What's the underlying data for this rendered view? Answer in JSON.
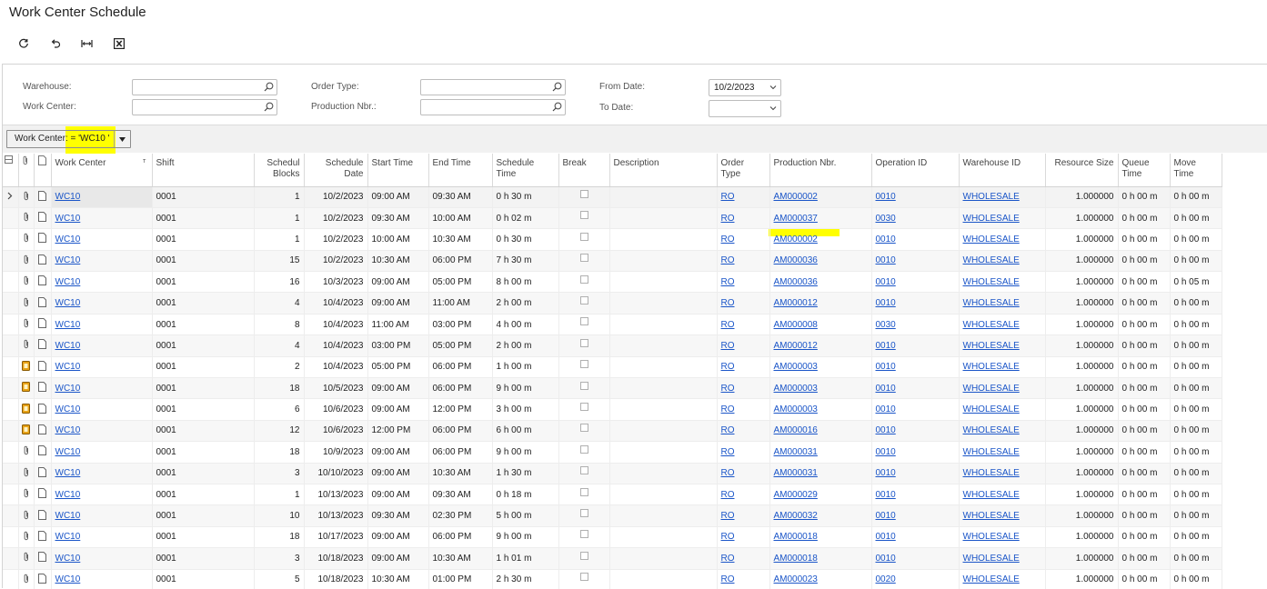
{
  "page": {
    "title": "Work Center Schedule"
  },
  "toolbar": {
    "icons": [
      "refresh-icon",
      "undo-icon",
      "fit-columns-icon",
      "export-excel-icon"
    ]
  },
  "form": {
    "warehouse_label": "Warehouse:",
    "work_center_label": "Work Center:",
    "order_type_label": "Order Type:",
    "production_nbr_label": "Production Nbr.:",
    "from_date_label": "From Date:",
    "from_date_value": "10/2/2023",
    "to_date_label": "To Date:",
    "to_date_value": ""
  },
  "filter": {
    "chip_label": "Work Center: = 'WC10 '"
  },
  "grid": {
    "columns": {
      "work_center": "Work Center",
      "shift": "Shift",
      "schedule_blocks": "Schedul Blocks",
      "schedule_date": "Schedule Date",
      "start_time": "Start Time",
      "end_time": "End Time",
      "schedule_time": "Schedule Time",
      "break": "Break",
      "description": "Description",
      "order_type": "Order Type",
      "production_nbr": "Production Nbr.",
      "operation_id": "Operation ID",
      "warehouse_id": "Warehouse ID",
      "resource_size": "Resource Size",
      "queue_time": "Queue Time",
      "move_time": "Move Time"
    },
    "rows": [
      {
        "wc": "WC10",
        "shift": "0001",
        "blocks": "1",
        "date": "10/2/2023",
        "start": "09:00 AM",
        "end": "09:30 AM",
        "sched": "0 h 30 m",
        "ot": "RO",
        "prod": "AM000002",
        "op": "0010",
        "wh": "WHOLESALE",
        "res": "1.000000",
        "queue": "0 h 00 m",
        "move": "0 h 00 m",
        "note": false
      },
      {
        "wc": "WC10",
        "shift": "0001",
        "blocks": "1",
        "date": "10/2/2023",
        "start": "09:30 AM",
        "end": "10:00 AM",
        "sched": "0 h 02 m",
        "ot": "RO",
        "prod": "AM000037",
        "op": "0030",
        "wh": "WHOLESALE",
        "res": "1.000000",
        "queue": "0 h 00 m",
        "move": "0 h 00 m",
        "note": false
      },
      {
        "wc": "WC10",
        "shift": "0001",
        "blocks": "1",
        "date": "10/2/2023",
        "start": "10:00 AM",
        "end": "10:30 AM",
        "sched": "0 h 30 m",
        "ot": "RO",
        "prod": "AM000002",
        "op": "0010",
        "wh": "WHOLESALE",
        "res": "1.000000",
        "queue": "0 h 00 m",
        "move": "0 h 00 m",
        "note": false
      },
      {
        "wc": "WC10",
        "shift": "0001",
        "blocks": "15",
        "date": "10/2/2023",
        "start": "10:30 AM",
        "end": "06:00 PM",
        "sched": "7 h 30 m",
        "ot": "RO",
        "prod": "AM000036",
        "op": "0010",
        "wh": "WHOLESALE",
        "res": "1.000000",
        "queue": "0 h 00 m",
        "move": "0 h 00 m",
        "note": false
      },
      {
        "wc": "WC10",
        "shift": "0001",
        "blocks": "16",
        "date": "10/3/2023",
        "start": "09:00 AM",
        "end": "05:00 PM",
        "sched": "8 h 00 m",
        "ot": "RO",
        "prod": "AM000036",
        "op": "0010",
        "wh": "WHOLESALE",
        "res": "1.000000",
        "queue": "0 h 00 m",
        "move": "0 h 05 m",
        "note": false
      },
      {
        "wc": "WC10",
        "shift": "0001",
        "blocks": "4",
        "date": "10/4/2023",
        "start": "09:00 AM",
        "end": "11:00 AM",
        "sched": "2 h 00 m",
        "ot": "RO",
        "prod": "AM000012",
        "op": "0010",
        "wh": "WHOLESALE",
        "res": "1.000000",
        "queue": "0 h 00 m",
        "move": "0 h 00 m",
        "note": false
      },
      {
        "wc": "WC10",
        "shift": "0001",
        "blocks": "8",
        "date": "10/4/2023",
        "start": "11:00 AM",
        "end": "03:00 PM",
        "sched": "4 h 00 m",
        "ot": "RO",
        "prod": "AM000008",
        "op": "0030",
        "wh": "WHOLESALE",
        "res": "1.000000",
        "queue": "0 h 00 m",
        "move": "0 h 00 m",
        "note": false
      },
      {
        "wc": "WC10",
        "shift": "0001",
        "blocks": "4",
        "date": "10/4/2023",
        "start": "03:00 PM",
        "end": "05:00 PM",
        "sched": "2 h 00 m",
        "ot": "RO",
        "prod": "AM000012",
        "op": "0010",
        "wh": "WHOLESALE",
        "res": "1.000000",
        "queue": "0 h 00 m",
        "move": "0 h 00 m",
        "note": false
      },
      {
        "wc": "WC10",
        "shift": "0001",
        "blocks": "2",
        "date": "10/4/2023",
        "start": "05:00 PM",
        "end": "06:00 PM",
        "sched": "1 h 00 m",
        "ot": "RO",
        "prod": "AM000003",
        "op": "0010",
        "wh": "WHOLESALE",
        "res": "1.000000",
        "queue": "0 h 00 m",
        "move": "0 h 00 m",
        "note": true
      },
      {
        "wc": "WC10",
        "shift": "0001",
        "blocks": "18",
        "date": "10/5/2023",
        "start": "09:00 AM",
        "end": "06:00 PM",
        "sched": "9 h 00 m",
        "ot": "RO",
        "prod": "AM000003",
        "op": "0010",
        "wh": "WHOLESALE",
        "res": "1.000000",
        "queue": "0 h 00 m",
        "move": "0 h 00 m",
        "note": true
      },
      {
        "wc": "WC10",
        "shift": "0001",
        "blocks": "6",
        "date": "10/6/2023",
        "start": "09:00 AM",
        "end": "12:00 PM",
        "sched": "3 h 00 m",
        "ot": "RO",
        "prod": "AM000003",
        "op": "0010",
        "wh": "WHOLESALE",
        "res": "1.000000",
        "queue": "0 h 00 m",
        "move": "0 h 00 m",
        "note": true
      },
      {
        "wc": "WC10",
        "shift": "0001",
        "blocks": "12",
        "date": "10/6/2023",
        "start": "12:00 PM",
        "end": "06:00 PM",
        "sched": "6 h 00 m",
        "ot": "RO",
        "prod": "AM000016",
        "op": "0010",
        "wh": "WHOLESALE",
        "res": "1.000000",
        "queue": "0 h 00 m",
        "move": "0 h 00 m",
        "note": true
      },
      {
        "wc": "WC10",
        "shift": "0001",
        "blocks": "18",
        "date": "10/9/2023",
        "start": "09:00 AM",
        "end": "06:00 PM",
        "sched": "9 h 00 m",
        "ot": "RO",
        "prod": "AM000031",
        "op": "0010",
        "wh": "WHOLESALE",
        "res": "1.000000",
        "queue": "0 h 00 m",
        "move": "0 h 00 m",
        "note": false
      },
      {
        "wc": "WC10",
        "shift": "0001",
        "blocks": "3",
        "date": "10/10/2023",
        "start": "09:00 AM",
        "end": "10:30 AM",
        "sched": "1 h 30 m",
        "ot": "RO",
        "prod": "AM000031",
        "op": "0010",
        "wh": "WHOLESALE",
        "res": "1.000000",
        "queue": "0 h 00 m",
        "move": "0 h 00 m",
        "note": false
      },
      {
        "wc": "WC10",
        "shift": "0001",
        "blocks": "1",
        "date": "10/13/2023",
        "start": "09:00 AM",
        "end": "09:30 AM",
        "sched": "0 h 18 m",
        "ot": "RO",
        "prod": "AM000029",
        "op": "0010",
        "wh": "WHOLESALE",
        "res": "1.000000",
        "queue": "0 h 00 m",
        "move": "0 h 00 m",
        "note": false
      },
      {
        "wc": "WC10",
        "shift": "0001",
        "blocks": "10",
        "date": "10/13/2023",
        "start": "09:30 AM",
        "end": "02:30 PM",
        "sched": "5 h 00 m",
        "ot": "RO",
        "prod": "AM000032",
        "op": "0010",
        "wh": "WHOLESALE",
        "res": "1.000000",
        "queue": "0 h 00 m",
        "move": "0 h 00 m",
        "note": false
      },
      {
        "wc": "WC10",
        "shift": "0001",
        "blocks": "18",
        "date": "10/17/2023",
        "start": "09:00 AM",
        "end": "06:00 PM",
        "sched": "9 h 00 m",
        "ot": "RO",
        "prod": "AM000018",
        "op": "0010",
        "wh": "WHOLESALE",
        "res": "1.000000",
        "queue": "0 h 00 m",
        "move": "0 h 00 m",
        "note": false
      },
      {
        "wc": "WC10",
        "shift": "0001",
        "blocks": "3",
        "date": "10/18/2023",
        "start": "09:00 AM",
        "end": "10:30 AM",
        "sched": "1 h 01 m",
        "ot": "RO",
        "prod": "AM000018",
        "op": "0010",
        "wh": "WHOLESALE",
        "res": "1.000000",
        "queue": "0 h 00 m",
        "move": "0 h 00 m",
        "note": false
      },
      {
        "wc": "WC10",
        "shift": "0001",
        "blocks": "5",
        "date": "10/18/2023",
        "start": "10:30 AM",
        "end": "01:00 PM",
        "sched": "2 h 30 m",
        "ot": "RO",
        "prod": "AM000023",
        "op": "0020",
        "wh": "WHOLESALE",
        "res": "1.000000",
        "queue": "0 h 00 m",
        "move": "0 h 00 m",
        "note": false
      }
    ]
  },
  "colors": {
    "link": "#1a55c8",
    "highlight": "#ffff00",
    "note_icon": "#e8a317"
  }
}
